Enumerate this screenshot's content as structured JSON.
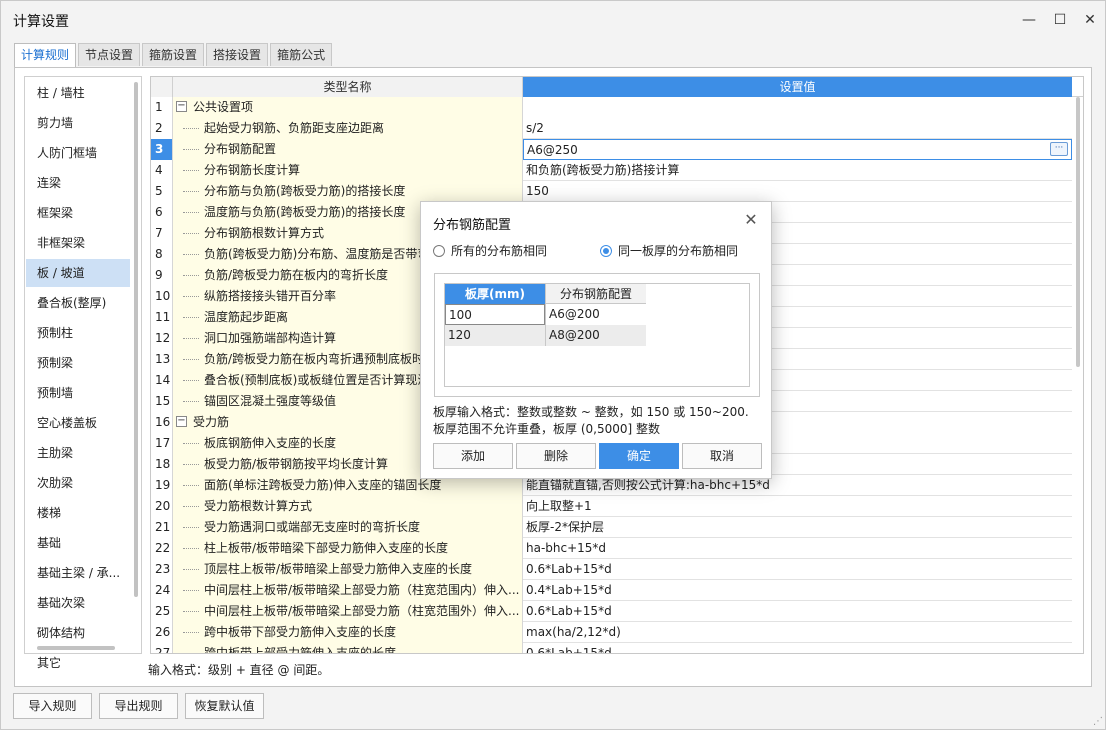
{
  "window": {
    "title": "计算设置",
    "minimize_label": "—",
    "maximize_label": "☐",
    "close_label": "✕"
  },
  "tabs": [
    {
      "label": "计算规则",
      "active": true
    },
    {
      "label": "节点设置"
    },
    {
      "label": "箍筋设置"
    },
    {
      "label": "搭接设置"
    },
    {
      "label": "箍筋公式"
    }
  ],
  "left_items": [
    "柱 / 墙柱",
    "剪力墙",
    "人防门框墙",
    "连梁",
    "框架梁",
    "非框架梁",
    "板 / 坡道",
    "叠合板(整厚)",
    "预制柱",
    "预制梁",
    "预制墙",
    "空心楼盖板",
    "主肋梁",
    "次肋梁",
    "楼梯",
    "基础",
    "基础主梁 / 承...",
    "基础次梁",
    "砌体结构",
    "其它"
  ],
  "left_selected_index": 6,
  "grid": {
    "header_name": "类型名称",
    "header_value": "设置值",
    "rows": [
      {
        "num": "1",
        "name": "公共设置项",
        "value": "",
        "group": true
      },
      {
        "num": "2",
        "name": "起始受力钢筋、负筋距支座边距离",
        "value": "s/2"
      },
      {
        "num": "3",
        "name": "分布钢筋配置",
        "value": "A6@250",
        "current": true
      },
      {
        "num": "4",
        "name": "分布钢筋长度计算",
        "value": "和负筋(跨板受力筋)搭接计算"
      },
      {
        "num": "5",
        "name": "分布筋与负筋(跨板受力筋)的搭接长度",
        "value": "150"
      },
      {
        "num": "6",
        "name": "温度筋与负筋(跨板受力筋)的搭接长度",
        "value": ""
      },
      {
        "num": "7",
        "name": "分布钢筋根数计算方式",
        "value": ""
      },
      {
        "num": "8",
        "name": "负筋(跨板受力筋)分布筋、温度筋是否带弯",
        "value": ""
      },
      {
        "num": "9",
        "name": "负筋/跨板受力筋在板内的弯折长度",
        "value": ""
      },
      {
        "num": "10",
        "name": "纵筋搭接接头错开百分率",
        "value": ""
      },
      {
        "num": "11",
        "name": "温度筋起步距离",
        "value": ""
      },
      {
        "num": "12",
        "name": "洞口加强筋端部构造计算",
        "value": ""
      },
      {
        "num": "13",
        "name": "负筋/跨板受力筋在板内弯折遇预制底板时",
        "value": ""
      },
      {
        "num": "14",
        "name": "叠合板(预制底板)或板缝位置是否计算现浇",
        "value": ""
      },
      {
        "num": "15",
        "name": "锚固区混凝土强度等级值",
        "value": ""
      },
      {
        "num": "16",
        "name": "受力筋",
        "value": "",
        "group": true
      },
      {
        "num": "17",
        "name": "板底钢筋伸入支座的长度",
        "value": ""
      },
      {
        "num": "18",
        "name": "板受力筋/板带钢筋按平均长度计算",
        "value": ""
      },
      {
        "num": "19",
        "name": "面筋(单标注跨板受力筋)伸入支座的锚固长度",
        "value": "能直锚就直锚,否则按公式计算:ha-bhc+15*d"
      },
      {
        "num": "20",
        "name": "受力筋根数计算方式",
        "value": "向上取整+1"
      },
      {
        "num": "21",
        "name": "受力筋遇洞口或端部无支座时的弯折长度",
        "value": "板厚-2*保护层"
      },
      {
        "num": "22",
        "name": "柱上板带/板带暗梁下部受力筋伸入支座的长度",
        "value": "ha-bhc+15*d"
      },
      {
        "num": "23",
        "name": "顶层柱上板带/板带暗梁上部受力筋伸入支座的长度",
        "value": "0.6*Lab+15*d"
      },
      {
        "num": "24",
        "name": "中间层柱上板带/板带暗梁上部受力筋（柱宽范围内）伸入...",
        "value": "0.4*Lab+15*d"
      },
      {
        "num": "25",
        "name": "中间层柱上板带/板带暗梁上部受力筋（柱宽范围外）伸入...",
        "value": "0.6*Lab+15*d"
      },
      {
        "num": "26",
        "name": "跨中板带下部受力筋伸入支座的长度",
        "value": "max(ha/2,12*d)"
      },
      {
        "num": "27",
        "name": "跨中板带上部受力筋伸入支座的长度",
        "value": "0.6*Lab+15*d"
      }
    ]
  },
  "input_format_hint": "输入格式：级别 + 直径 @ 间距。",
  "bottom_buttons": {
    "import": "导入规则",
    "export": "导出规则",
    "restore": "恢复默认值"
  },
  "modal": {
    "title": "分布钢筋配置",
    "close_label": "✕",
    "radio_all": "所有的分布筋相同",
    "radio_same_thickness": "同一板厚的分布筋相同",
    "selected_radio": "same_thickness",
    "table_headers": [
      "板厚(mm)",
      "分布钢筋配置"
    ],
    "table_rows": [
      {
        "thickness": "100",
        "config": "A6@200"
      },
      {
        "thickness": "120",
        "config": "A8@200"
      }
    ],
    "hint_line1": "板厚输入格式：整数或整数 ~ 整数，如 150 或 150~200.",
    "hint_line2": "板厚范围不允许重叠，板厚 (0,5000] 整数",
    "buttons": {
      "add": "添加",
      "delete": "删除",
      "ok": "确定",
      "cancel": "取消"
    }
  },
  "icons": {
    "ellipsis": "···",
    "collapse": "−",
    "resize_grip": "⋰"
  },
  "colors": {
    "accent": "#3d8ee6",
    "name_column_bg": "#fffde6",
    "selected_item_bg": "#cde0f5"
  }
}
